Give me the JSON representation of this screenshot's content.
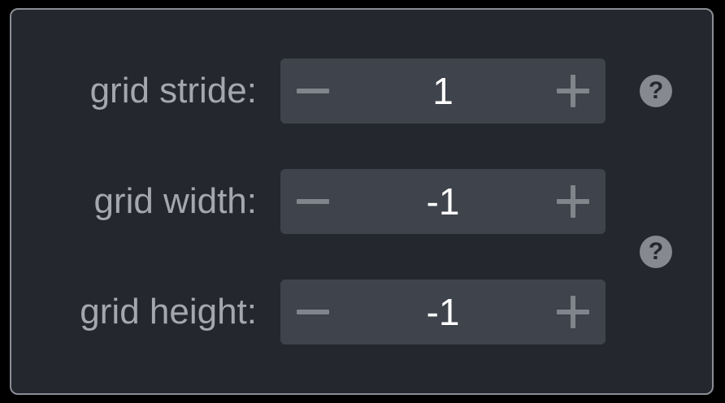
{
  "fields": [
    {
      "label": "grid stride:",
      "value": "1"
    },
    {
      "label": "grid width:",
      "value": "-1"
    },
    {
      "label": "grid height:",
      "value": "-1"
    }
  ],
  "stepper_icons": {
    "decrement": "minus-icon",
    "increment": "plus-icon"
  },
  "help_icon": {
    "name": "question-mark-icon",
    "glyph": "?"
  },
  "colors": {
    "panel_bg": "#25272e",
    "panel_border": "#8a8d94",
    "stepper_bg": "#3f434c",
    "label_text": "#a4a7ad",
    "value_text": "#ffffff",
    "icon_gray": "#868a90"
  }
}
